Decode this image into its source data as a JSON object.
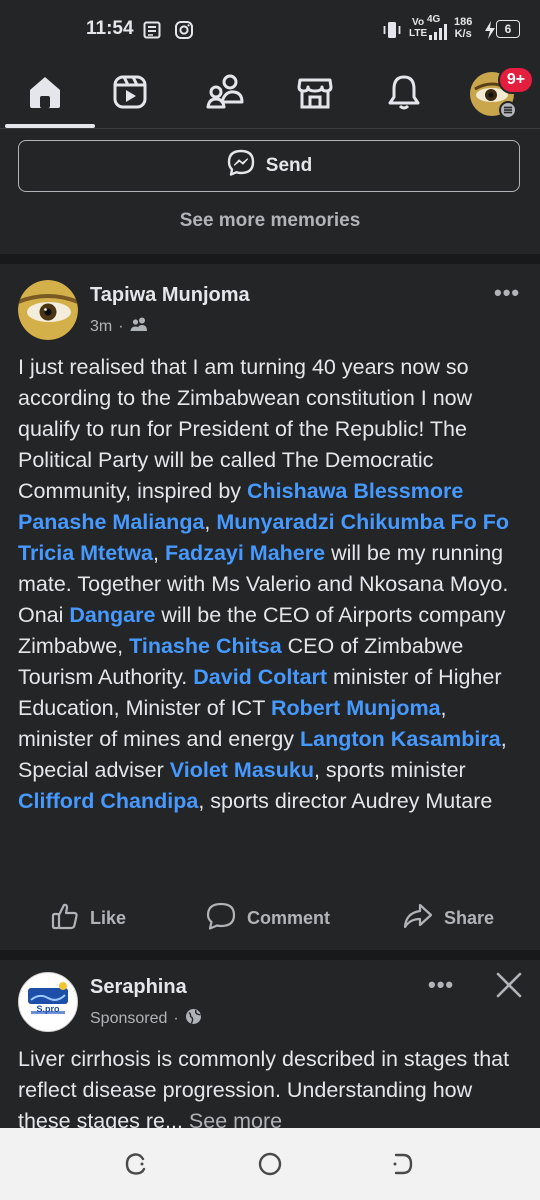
{
  "status": {
    "time": "11:54",
    "network_top": "Vo",
    "network_bottom": "LTE",
    "gen": "4G",
    "speed_value": "186",
    "speed_unit": "K/s",
    "battery": "6"
  },
  "nav": {
    "badge": "9+",
    "items": [
      "home-icon",
      "video-icon",
      "friends-icon",
      "marketplace-icon",
      "notifications-icon",
      "menu-avatar"
    ]
  },
  "memories": {
    "send_label": "Send",
    "see_more_label": "See more memories"
  },
  "post": {
    "author": "Tapiwa Munjoma",
    "time": "3m",
    "separator": "·",
    "segments": [
      {
        "t": "I just realised that I am turning 40 years now so according to the Zimbabwean constitution I now qualify to run for President of the Republic! The Political Party will be called The Democratic Community, inspired by ",
        "tag": false
      },
      {
        "t": "Chishawa Blessmore Panashe Malianga",
        "tag": true
      },
      {
        "t": ", ",
        "tag": false
      },
      {
        "t": "Munyaradzi Chikumba",
        "tag": true
      },
      {
        "t": "  ",
        "tag": false
      },
      {
        "t": "Fo Fo Tricia Mtetwa",
        "tag": true
      },
      {
        "t": ", ",
        "tag": false
      },
      {
        "t": "Fadzayi Mahere",
        "tag": true
      },
      {
        "t": " will be my running mate. Together with Ms Valerio and Nkosana Moyo. Onai ",
        "tag": false
      },
      {
        "t": "Dangare",
        "tag": true
      },
      {
        "t": " will be the CEO of Airports company Zimbabwe, ",
        "tag": false
      },
      {
        "t": "Tinashe Chitsa",
        "tag": true
      },
      {
        "t": " CEO of Zimbabwe Tourism Authority. ",
        "tag": false
      },
      {
        "t": "David Coltart",
        "tag": true
      },
      {
        "t": " minister of Higher Education, Minister of ICT ",
        "tag": false
      },
      {
        "t": "Robert Munjoma",
        "tag": true
      },
      {
        "t": ", minister of mines and energy ",
        "tag": false
      },
      {
        "t": "Langton Kasambira",
        "tag": true
      },
      {
        "t": ", Special adviser ",
        "tag": false
      },
      {
        "t": "Violet Masuku",
        "tag": true
      },
      {
        "t": ", sports minister ",
        "tag": false
      },
      {
        "t": "Clifford Chandipa",
        "tag": true
      },
      {
        "t": ", sports director Audrey Mutare",
        "tag": false
      }
    ],
    "actions": {
      "like": "Like",
      "comment": "Comment",
      "share": "Share"
    }
  },
  "ad": {
    "author": "Seraphina",
    "logo_text": "S.pro",
    "sponsored": "Sponsored",
    "separator": "·",
    "text": "Liver cirrhosis is commonly described in stages that reflect disease progression. Understanding how these stages re...",
    "see_more": " See more"
  },
  "colors": {
    "background": "#242526",
    "separator": "#18191a",
    "text": "#e4e6eb",
    "muted": "#b0b3b8",
    "tag": "#4599ff",
    "badge": "#e41e3f"
  }
}
